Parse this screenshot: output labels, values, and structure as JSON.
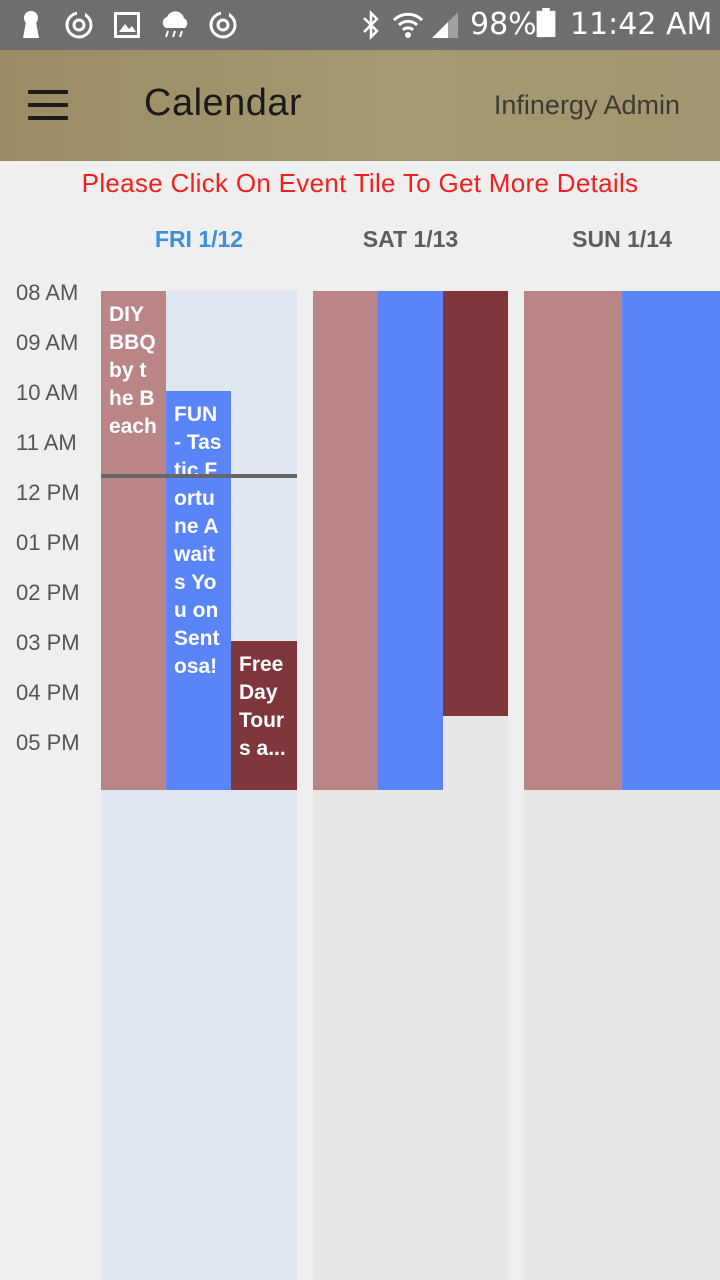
{
  "status_bar": {
    "battery": "98%",
    "time": "11:42 AM"
  },
  "app_bar": {
    "title": "Calendar",
    "user": "Infinergy Admin",
    "menu_icon": "hamburger-menu-icon"
  },
  "notice": "Please Click On Event Tile To Get More Details",
  "days": [
    {
      "label": "FRI 1/12",
      "today": true
    },
    {
      "label": "SAT 1/13",
      "today": false
    },
    {
      "label": "SUN 1/14",
      "today": false
    }
  ],
  "time_slots": [
    "08 AM",
    "09 AM",
    "10 AM",
    "11 AM",
    "12 PM",
    "01 PM",
    "02 PM",
    "03 PM",
    "04 PM",
    "05 PM"
  ],
  "events": {
    "fri": [
      {
        "title": "DIY BBQ by the Beach",
        "color": "#b98587"
      },
      {
        "title": "FUN - Tastic Fortune Awaits You on Sentosa!",
        "color": "#5a84fa"
      },
      {
        "title": "Free Day Tours a...",
        "color": "#7e363a"
      }
    ],
    "sat": [
      {
        "title": "",
        "color": "#b98587"
      },
      {
        "title": "",
        "color": "#5a84fa"
      },
      {
        "title": "",
        "color": "#7e363a"
      }
    ],
    "sun": [
      {
        "title": "",
        "color": "#b98587"
      },
      {
        "title": "",
        "color": "#5a84fa"
      }
    ]
  },
  "colors": {
    "today_column": "#e1e7f1",
    "other_column": "#e7e7e9",
    "today_header": "#3b8fdc",
    "notice": "#f0201e"
  }
}
